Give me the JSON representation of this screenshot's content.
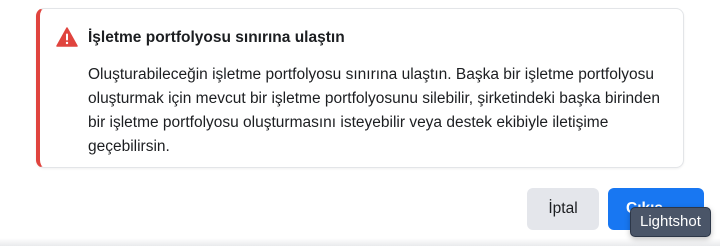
{
  "alert": {
    "title": "İşletme portfolyosu sınırına ulaştın",
    "body": "Oluşturabileceğin işletme portfolyosu sınırına ulaştın. Başka bir işletme portfolyosu oluşturmak için mevcut bir işletme portfolyosunu silebilir, şirketindeki başka birinden bir işletme portfolyosu oluşturmasını isteyebilir veya destek ekibiyle iletişime geçebilirsin.",
    "icon": "warning-triangle-icon",
    "accent_color": "#e0443e"
  },
  "actions": {
    "cancel_label": "İptal",
    "primary_label": "Çıkış",
    "primary_color": "#1877f2"
  },
  "tooltip": {
    "label": "Lightshot"
  }
}
